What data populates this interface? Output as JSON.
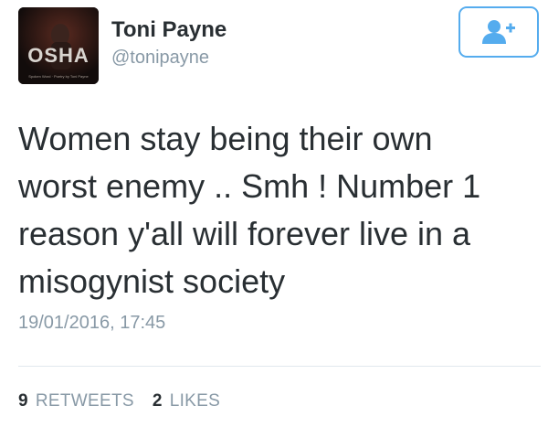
{
  "tweet": {
    "author": {
      "display_name": "Toni Payne",
      "handle": "@tonipayne",
      "avatar_text": "OSHA",
      "avatar_caption": "Spoken Word · Poetry by Toni Payne",
      "avatar_icon": "profile-photo"
    },
    "follow_button": {
      "icon": "add-user-icon"
    },
    "text_lines": [
      "Women stay being their own",
      "worst enemy .. Smh ! Number 1",
      "reason y'all will forever live in a",
      "misogynist society"
    ],
    "timestamp": "19/01/2016, 17:45",
    "stats": {
      "retweets": {
        "count": "9",
        "label": "RETWEETS"
      },
      "likes": {
        "count": "2",
        "label": "LIKES"
      }
    }
  },
  "colors": {
    "text": "#292f33",
    "secondary": "#8899a6",
    "accent": "#55acee",
    "divider": "#e1e8ed"
  }
}
